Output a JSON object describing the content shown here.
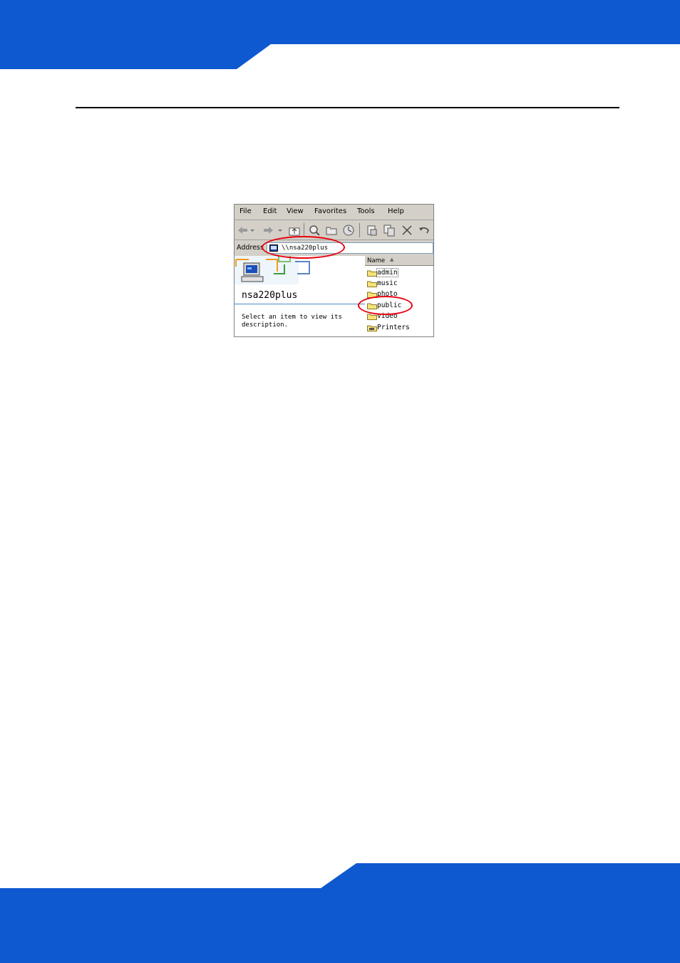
{
  "colors": {
    "brand_blue": "#0e59d0",
    "highlight_red": "#e8000d",
    "chrome_gray": "#d4d0c8"
  },
  "explorer": {
    "menu": [
      "File",
      "Edit",
      "View",
      "Favorites",
      "Tools",
      "Help"
    ],
    "toolbar_icons": [
      "back-icon",
      "dropdown-icon",
      "forward-icon",
      "dropdown-icon",
      "up-folder-icon",
      "search-icon",
      "folders-icon",
      "history-icon",
      "move-to-icon",
      "copy-to-icon",
      "delete-icon",
      "undo-icon"
    ],
    "address": {
      "label": "Address",
      "value": "\\\\nsa220plus"
    },
    "left_pane": {
      "title": "nsa220plus",
      "description": "Select an item to view its description."
    },
    "list": {
      "column": "Name",
      "items": [
        "admin",
        "music",
        "photo",
        "public",
        "video",
        "Printers"
      ]
    }
  }
}
